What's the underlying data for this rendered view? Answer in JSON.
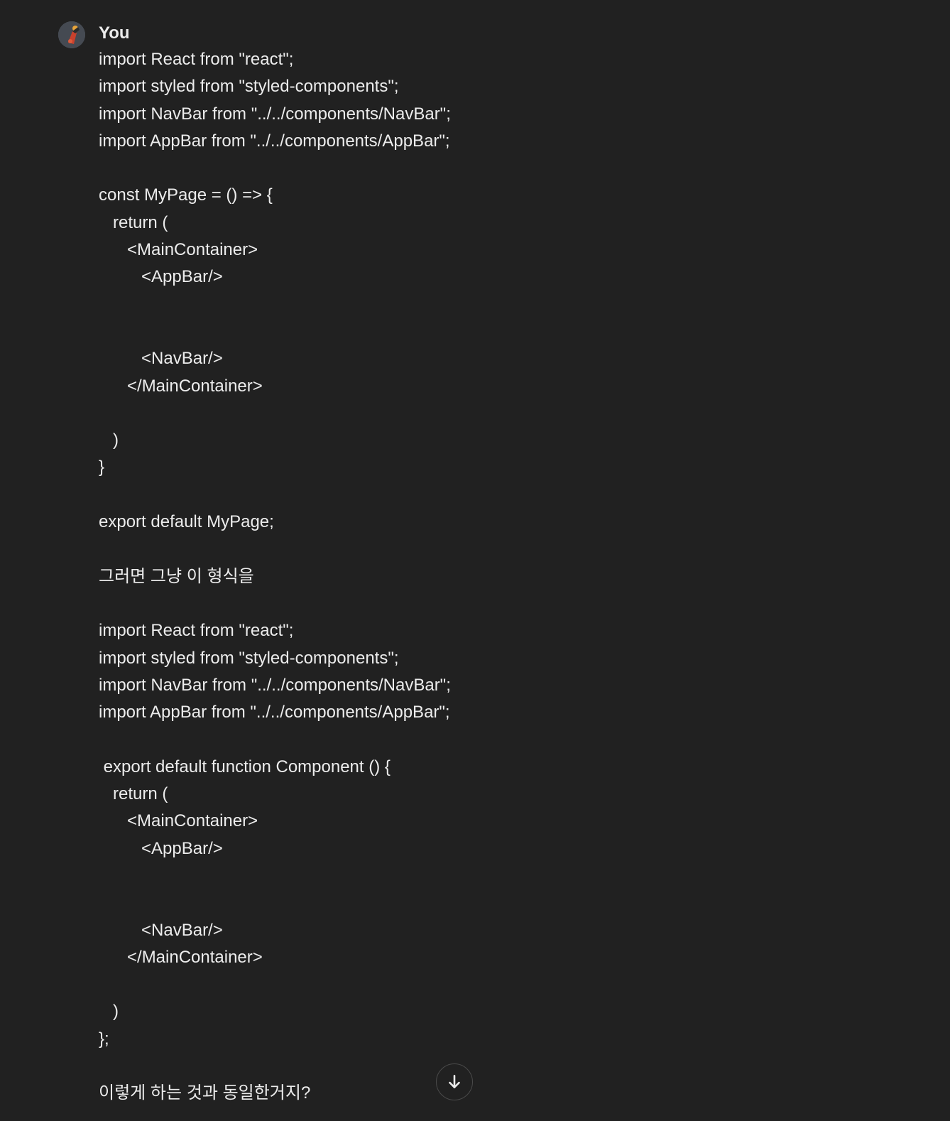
{
  "message": {
    "author": "You",
    "lines": [
      "import React from \"react\";",
      "import styled from \"styled-components\";",
      "import NavBar from \"../../components/NavBar\";",
      "import AppBar from \"../../components/AppBar\";",
      "",
      "const MyPage = () => {",
      "   return (",
      "      <MainContainer>",
      "         <AppBar/>",
      "",
      "",
      "         <NavBar/>",
      "      </MainContainer>",
      "",
      "   )",
      "}",
      "",
      "export default MyPage;",
      "",
      "그러면 그냥 이 형식을",
      "",
      "import React from \"react\";",
      "import styled from \"styled-components\";",
      "import NavBar from \"../../components/NavBar\";",
      "import AppBar from \"../../components/AppBar\";",
      "",
      " export default function Component () {",
      "   return (",
      "      <MainContainer>",
      "         <AppBar/>",
      "",
      "",
      "         <NavBar/>",
      "      </MainContainer>",
      "",
      "   )",
      "};",
      "",
      "이렇게 하는 것과 동일한거지?"
    ]
  },
  "scroll_button": {
    "icon": "arrow-down-icon"
  }
}
